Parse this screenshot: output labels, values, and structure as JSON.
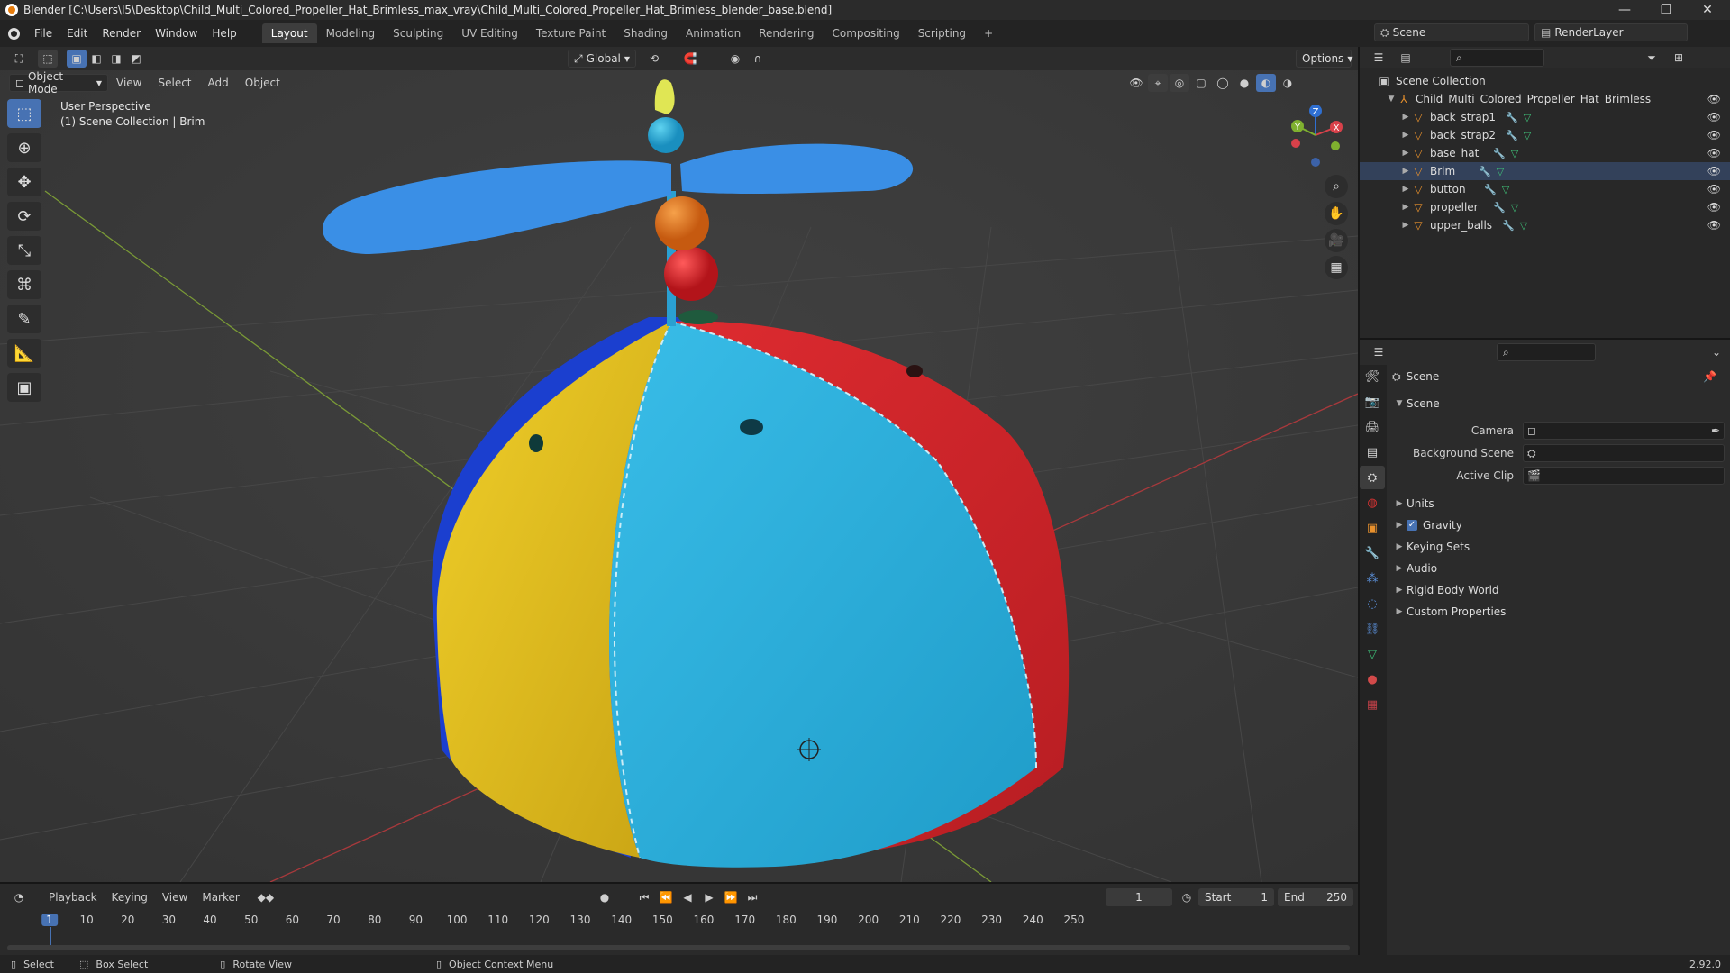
{
  "window": {
    "title": "Blender [C:\\Users\\l5\\Desktop\\Child_Multi_Colored_Propeller_Hat_Brimless_max_vray\\Child_Multi_Colored_Propeller_Hat_Brimless_blender_base.blend]",
    "minimize": "—",
    "maximize": "❐",
    "close": "✕"
  },
  "menu": [
    "File",
    "Edit",
    "Render",
    "Window",
    "Help"
  ],
  "workspaces": [
    {
      "label": "Layout",
      "active": true
    },
    {
      "label": "Modeling"
    },
    {
      "label": "Sculpting"
    },
    {
      "label": "UV Editing"
    },
    {
      "label": "Texture Paint"
    },
    {
      "label": "Shading"
    },
    {
      "label": "Animation"
    },
    {
      "label": "Rendering"
    },
    {
      "label": "Compositing"
    },
    {
      "label": "Scripting"
    }
  ],
  "add_workspace": "+",
  "scene": {
    "label": "Scene",
    "render_layer": "RenderLayer"
  },
  "viewport": {
    "transform_orientation": "Global",
    "options": "Options",
    "mode": "Object Mode",
    "menus": [
      "View",
      "Select",
      "Add",
      "Object"
    ],
    "overlay_line1": "User Perspective",
    "overlay_line2": "(1) Scene Collection | Brim",
    "gizmo": {
      "x": "X",
      "y": "Y",
      "z": "Z"
    }
  },
  "outliner": {
    "root": "Scene Collection",
    "collection": "Child_Multi_Colored_Propeller_Hat_Brimless",
    "objects": [
      "back_strap1",
      "back_strap2",
      "base_hat",
      "Brim",
      "button",
      "propeller",
      "upper_balls"
    ]
  },
  "properties": {
    "header": "Scene",
    "section": "Scene",
    "fields": [
      {
        "label": "Camera",
        "value": ""
      },
      {
        "label": "Background Scene",
        "value": ""
      },
      {
        "label": "Active Clip",
        "value": ""
      }
    ],
    "panels": [
      {
        "label": "Units",
        "checkbox": false
      },
      {
        "label": "Gravity",
        "checkbox": true
      },
      {
        "label": "Keying Sets",
        "checkbox": false
      },
      {
        "label": "Audio",
        "checkbox": false
      },
      {
        "label": "Rigid Body World",
        "checkbox": false
      },
      {
        "label": "Custom Properties",
        "checkbox": false
      }
    ]
  },
  "timeline": {
    "menus": [
      "Playback",
      "Keying",
      "View",
      "Marker"
    ],
    "current_frame": "1",
    "start_label": "Start",
    "start": "1",
    "end_label": "End",
    "end": "250",
    "ticks": [
      "1",
      "10",
      "20",
      "30",
      "40",
      "50",
      "60",
      "70",
      "80",
      "90",
      "100",
      "110",
      "120",
      "130",
      "140",
      "150",
      "160",
      "170",
      "180",
      "190",
      "200",
      "210",
      "220",
      "230",
      "240",
      "250"
    ]
  },
  "status": {
    "select": "Select",
    "box_select": "Box Select",
    "rotate_view": "Rotate View",
    "context_menu": "Object Context Menu",
    "version": "2.92.0"
  },
  "colors": {
    "accent": "#4772b3",
    "object_icon": "#e8912d",
    "hat_yellow": "#e8c21a",
    "hat_cyan": "#2aa7d6",
    "hat_red": "#d7262c",
    "hat_blue": "#1b3fcf",
    "propeller": "#3a8fe6"
  }
}
